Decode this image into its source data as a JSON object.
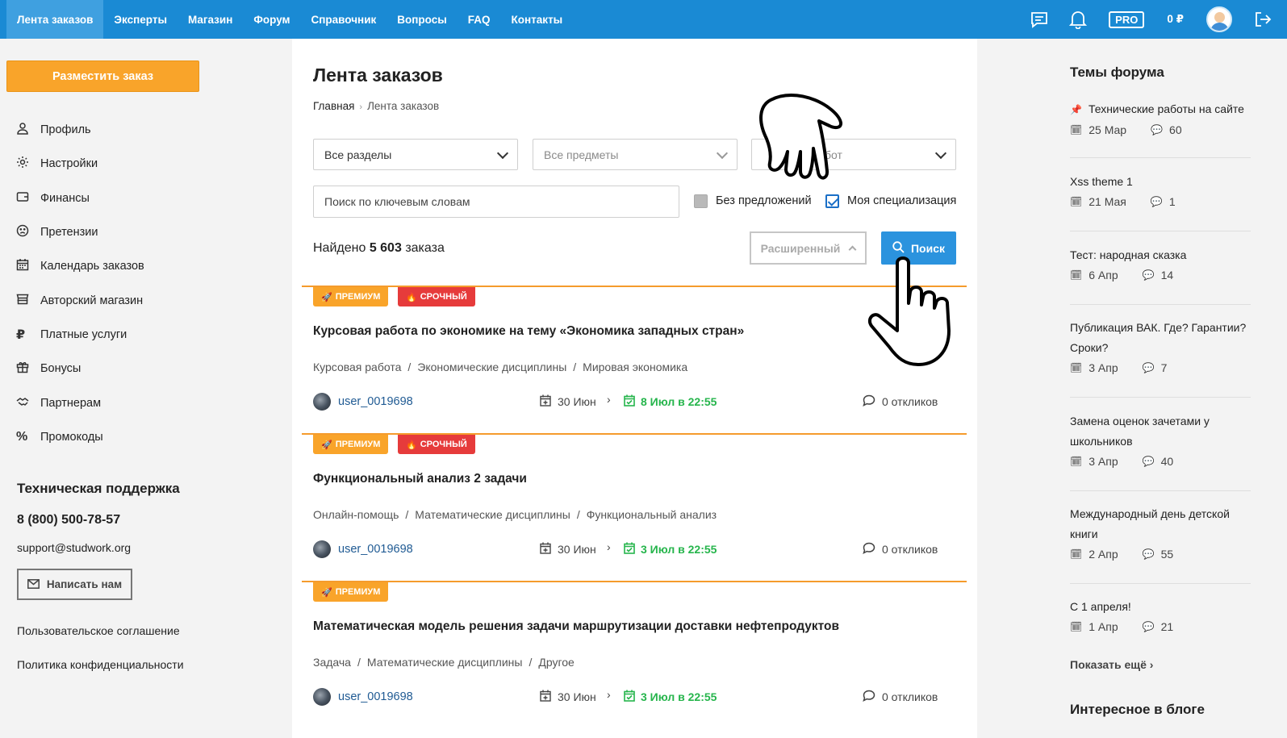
{
  "nav": {
    "items": [
      "Лента заказов",
      "Эксперты",
      "Магазин",
      "Форум",
      "Справочник",
      "Вопросы",
      "FAQ",
      "Контакты"
    ],
    "pro_label": "PRO",
    "balance": "0 ₽"
  },
  "sidebar": {
    "place_order": "Разместить заказ",
    "menu": [
      {
        "label": "Профиль",
        "icon": "user-icon"
      },
      {
        "label": "Настройки",
        "icon": "gear-icon"
      },
      {
        "label": "Финансы",
        "icon": "wallet-icon"
      },
      {
        "label": "Претензии",
        "icon": "sad-face-icon"
      },
      {
        "label": "Календарь заказов",
        "icon": "calendar-icon"
      },
      {
        "label": "Авторский магазин",
        "icon": "store-icon"
      },
      {
        "label": "Платные услуги",
        "icon": "ruble-icon"
      },
      {
        "label": "Бонусы",
        "icon": "gift-icon"
      },
      {
        "label": "Партнерам",
        "icon": "handshake-icon"
      },
      {
        "label": "Промокоды",
        "icon": "percent-icon"
      }
    ],
    "support_title": "Техническая поддержка",
    "support_phone": "8 (800) 500-78-57",
    "support_email": "support@studwork.org",
    "write_us": "Написать нам",
    "legal_terms": "Пользовательское соглашение",
    "legal_privacy": "Политика конфиденциальности"
  },
  "main": {
    "title": "Лента заказов",
    "breadcrumbs": [
      "Главная",
      "Лента заказов"
    ],
    "filters": {
      "sections": "Все разделы",
      "subjects": "Все предметы",
      "work_types": "бот",
      "search_placeholder": "Поиск по ключевым словам",
      "no_offers_label": "Без предложений",
      "no_offers_checked": false,
      "my_spec_label": "Моя специализация",
      "my_spec_checked": true
    },
    "found_prefix": "Найдено",
    "found_count": "5 603",
    "found_suffix": "заказа",
    "advanced_label": "Расширенный",
    "search_label": "Поиск",
    "orders": [
      {
        "badges": [
          "ПРЕМИУМ",
          "СРОЧНЫЙ"
        ],
        "title": "Курсовая работа по экономике на тему «Экономика западных стран»",
        "cats": [
          "Курсовая работа",
          "Экономические дисциплины",
          "Мировая экономика"
        ],
        "user": "user_0019698",
        "date": "30 Июн",
        "deadline": "8 Июл в 22:55",
        "responses": "0 откликов"
      },
      {
        "badges": [
          "ПРЕМИУМ",
          "СРОЧНЫЙ"
        ],
        "title": "Функциональный анализ 2 задачи",
        "cats": [
          "Онлайн-помощь",
          "Математические дисциплины",
          "Функциональный анализ"
        ],
        "user": "user_0019698",
        "date": "30 Июн",
        "deadline": "3 Июл в 22:55",
        "responses": "0 откликов"
      },
      {
        "badges": [
          "ПРЕМИУМ"
        ],
        "title": "Математическая модель решения задачи маршрутизации доставки нефтепродуктов",
        "cats": [
          "Задача",
          "Математические дисциплины",
          "Другое"
        ],
        "user": "user_0019698",
        "date": "30 Июн",
        "deadline": "3 Июл в 22:55",
        "responses": "0 откликов"
      }
    ]
  },
  "forum": {
    "title": "Темы форума",
    "topics": [
      {
        "title": "Технические работы на сайте",
        "pinned": true,
        "date": "25 Мар",
        "count": "60"
      },
      {
        "title": "Xss theme 1",
        "date": "21 Мая",
        "count": "1"
      },
      {
        "title": "Тест: народная сказка",
        "date": "6 Апр",
        "count": "14"
      },
      {
        "title": "Публикация ВАК. Где? Гарантии? Сроки?",
        "date": "3 Апр",
        "count": "7"
      },
      {
        "title": "Замена оценок зачетами у школьников",
        "date": "3 Апр",
        "count": "40"
      },
      {
        "title": "Международный день детской книги",
        "date": "2 Апр",
        "count": "55"
      },
      {
        "title": "С 1 апреля!",
        "date": "1 Апр",
        "count": "21"
      }
    ],
    "show_more": "Показать ещё",
    "blog_title": "Интересное в блоге"
  }
}
